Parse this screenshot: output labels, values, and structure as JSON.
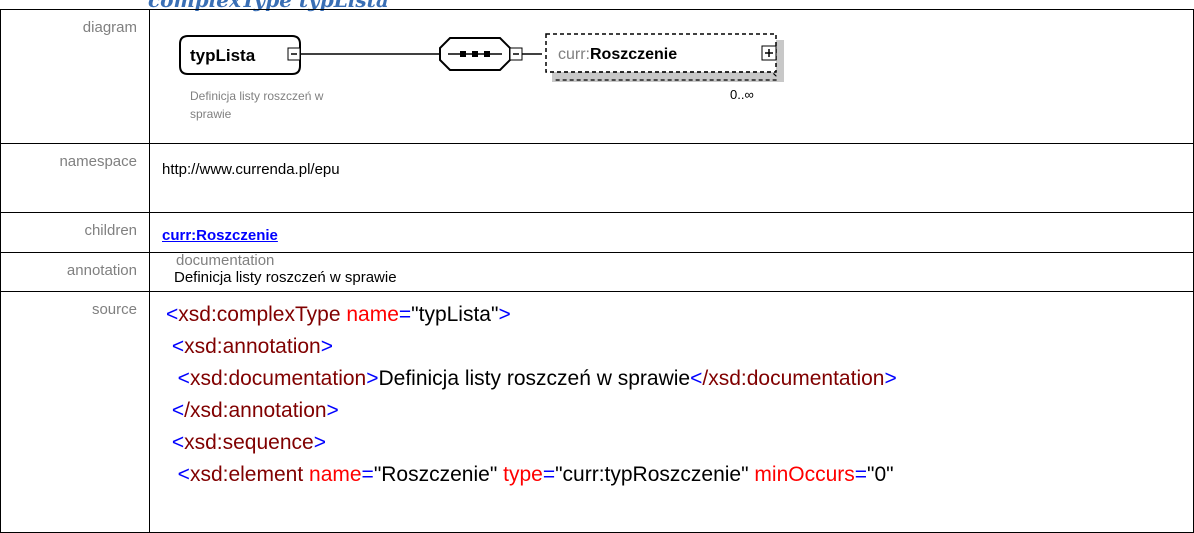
{
  "heading": "complexType typLista",
  "rows": {
    "diagram": {
      "label": "diagram"
    },
    "namespace": {
      "label": "namespace",
      "value": "http://www.currenda.pl/epu"
    },
    "children": {
      "label": "children",
      "value": "curr:Roszczenie"
    },
    "annotation": {
      "label": "annotation",
      "head": "documentation",
      "value": "Definicja listy roszczeń w sprawie"
    },
    "source": {
      "label": "source"
    }
  },
  "diagram": {
    "type_name": "typLista",
    "type_doc_line1": "Definicja listy roszczeń w",
    "type_doc_line2": "sprawie",
    "child_prefix": "curr:",
    "child_name": "Roszczenie",
    "cardinality": "0..∞"
  },
  "source": {
    "l1_tag": "xsd:complexType",
    "l1_attr": "name",
    "l1_val": "\"typLista\"",
    "l2_tag": "xsd:annotation",
    "l3_tag": "xsd:documentation",
    "l3_text": "Definicja listy roszczeń w sprawie",
    "l3_close": "/xsd:documentation",
    "l4_close": "/xsd:annotation",
    "l5_tag": "xsd:sequence",
    "l6_tag": "xsd:element",
    "l6_a1": "name",
    "l6_v1": "\"Roszczenie\"",
    "l6_a2": "type",
    "l6_v2": "\"curr:typRoszczenie\"",
    "l6_a3": "minOccurs",
    "l6_v3": "\"0\""
  },
  "colors": {
    "heading": "#3a6fb5",
    "link": "#0000ff",
    "tag": "#800000",
    "attr": "#ff0000",
    "bracket": "#0000ff"
  }
}
